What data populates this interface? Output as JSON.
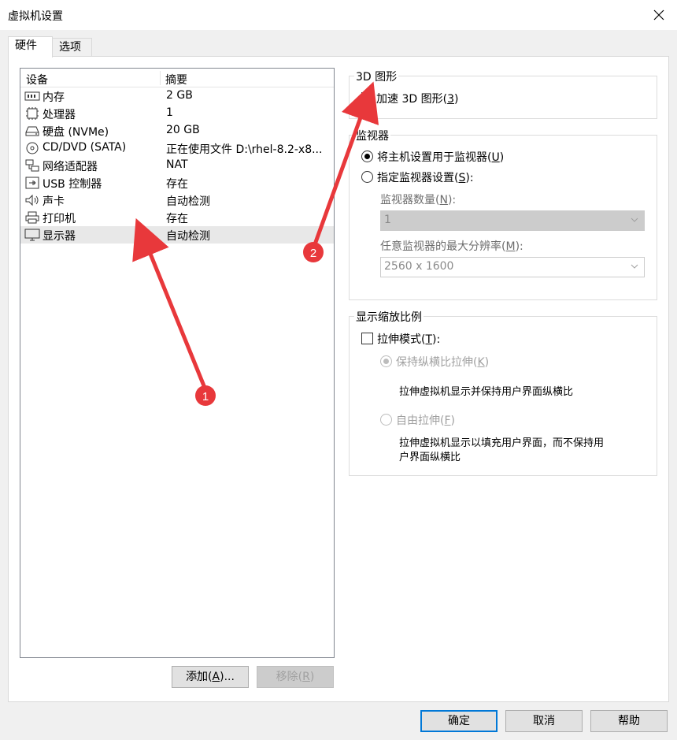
{
  "window": {
    "title": "虚拟机设置"
  },
  "tabs": [
    {
      "label": "硬件"
    },
    {
      "label": "选项"
    }
  ],
  "device_list": {
    "columns": {
      "device": "设备",
      "summary": "摘要"
    },
    "rows": [
      {
        "name": "内存",
        "summary": "2 GB",
        "icon": "memory-icon"
      },
      {
        "name": "处理器",
        "summary": "1",
        "icon": "cpu-icon"
      },
      {
        "name": "硬盘 (NVMe)",
        "summary": "20 GB",
        "icon": "harddisk-icon"
      },
      {
        "name": "CD/DVD (SATA)",
        "summary": "正在使用文件 D:\\rhel-8.2-x8...",
        "icon": "cd-icon"
      },
      {
        "name": "网络适配器",
        "summary": "NAT",
        "icon": "network-icon"
      },
      {
        "name": "USB 控制器",
        "summary": "存在",
        "icon": "usb-icon"
      },
      {
        "name": "声卡",
        "summary": "自动检测",
        "icon": "speaker-icon"
      },
      {
        "name": "打印机",
        "summary": "存在",
        "icon": "printer-icon"
      },
      {
        "name": "显示器",
        "summary": "自动检测",
        "icon": "monitor-icon",
        "selected": true
      }
    ]
  },
  "buttons": {
    "add": {
      "text": "添加(",
      "key": "A",
      "suffix": ")..."
    },
    "remove": {
      "text": "移除(",
      "key": "R",
      "suffix": ")"
    },
    "ok": "确定",
    "cancel": "取消",
    "help": "帮助"
  },
  "graphics3d": {
    "title": "3D 图形",
    "accelerate": {
      "text": "加速 3D 图形(",
      "key": "3",
      "suffix": ")",
      "checked": false
    }
  },
  "monitors": {
    "title": "监视器",
    "use_host": {
      "text": "将主机设置用于监视器(",
      "key": "U",
      "suffix": ")",
      "checked": true
    },
    "specify": {
      "text": "指定监视器设置(",
      "key": "S",
      "suffix": "):",
      "checked": false
    },
    "count_label": {
      "text": "监视器数量(",
      "key": "N",
      "suffix": "):"
    },
    "count_value": "1",
    "max_res_label": {
      "text": "任意监视器的最大分辨率(",
      "key": "M",
      "suffix": "):"
    },
    "max_res_value": "2560 x 1600"
  },
  "scaling": {
    "title": "显示缩放比例",
    "stretch": {
      "text": "拉伸模式(",
      "key": "T",
      "suffix": "):",
      "checked": false
    },
    "keep_ratio": {
      "text": "保持纵横比拉伸(",
      "key": "K",
      "suffix": ")",
      "checked": true
    },
    "keep_ratio_desc": "拉伸虚拟机显示并保持用户界面纵横比",
    "free": {
      "text": "自由拉伸(",
      "key": "F",
      "suffix": ")",
      "checked": false
    },
    "free_desc_1": "拉伸虚拟机显示以填充用户界面，而不保持用",
    "free_desc_2": "户界面纵横比"
  },
  "annotations": [
    {
      "label": "1"
    },
    {
      "label": "2"
    }
  ],
  "colors": {
    "arrow": "#e8383b",
    "accent": "#0078d7"
  }
}
